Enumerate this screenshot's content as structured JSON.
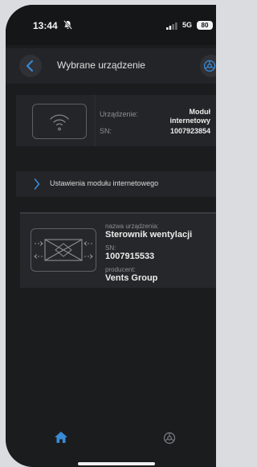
{
  "status_bar": {
    "time": "13:44",
    "network": "5G",
    "battery": "80"
  },
  "header": {
    "title": "Wybrane urządzenie",
    "back_icon": "chevron-left-icon",
    "settings_icon": "gear-icon"
  },
  "module": {
    "device_label": "Urządzenie:",
    "device_value_line1": "Moduł",
    "device_value_line2": "internetowy",
    "sn_label": "SN:",
    "sn_value": "1007923854",
    "icon": "wifi-icon"
  },
  "settings_row": {
    "label": "Ustawienia modułu internetowego",
    "icon": "chevron-right-icon"
  },
  "device": {
    "name_label": "nazwa urządzenia:",
    "name_value": "Sterownik wentylacji",
    "sn_label": "SN:",
    "sn_value": "1007915533",
    "producer_label": "producent:",
    "producer_value": "Vents Group",
    "icon": "heat-exchanger-icon"
  },
  "tabbar": {
    "home_icon": "home-icon",
    "settings_icon": "gear-icon"
  },
  "colors": {
    "accent": "#3a8bd6",
    "background": "#1b1c1e",
    "card": "#242528"
  }
}
